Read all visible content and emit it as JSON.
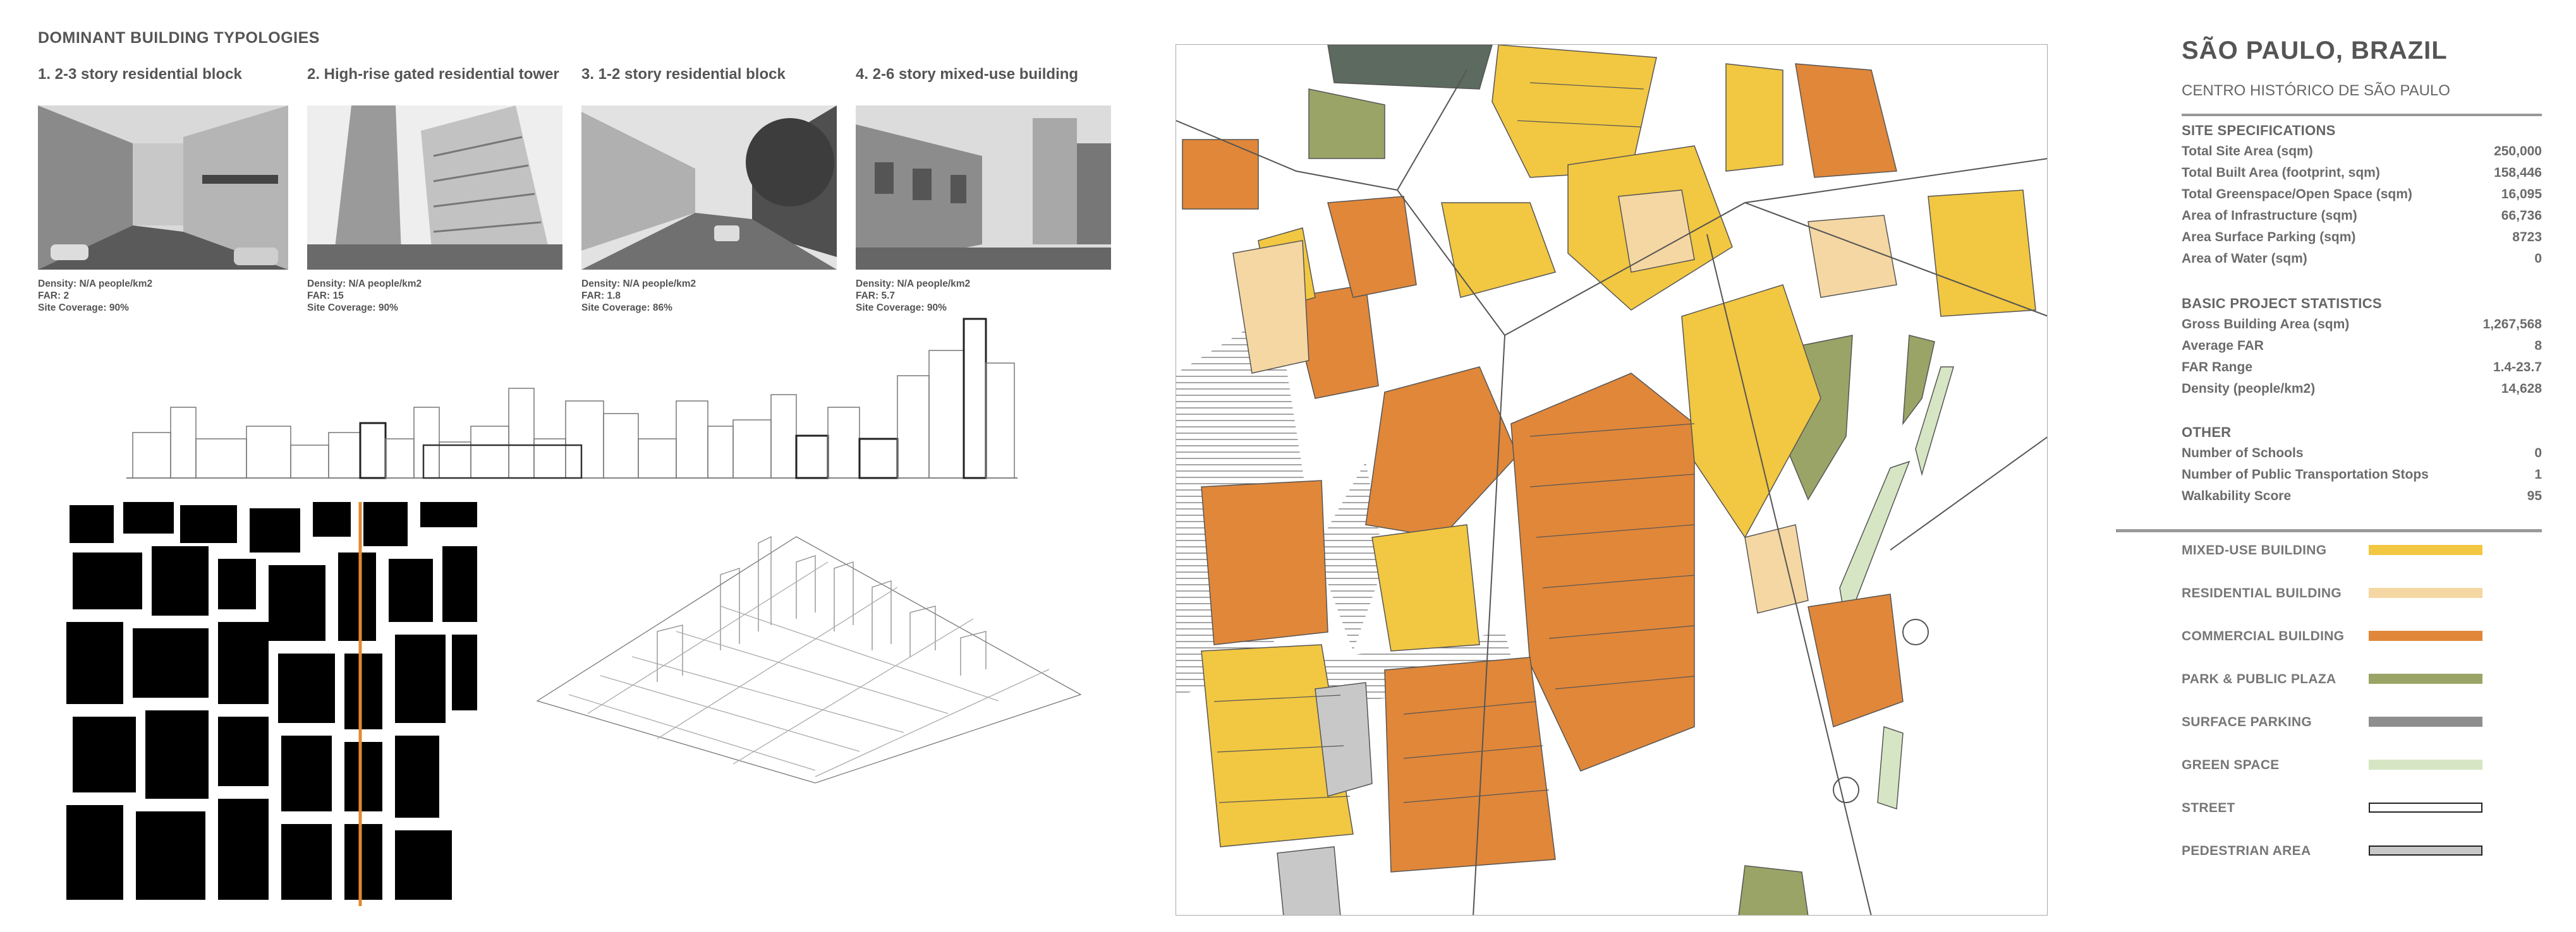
{
  "left": {
    "heading": "DOMINANT BUILDING TYPOLOGIES",
    "typologies": [
      {
        "title": "1. 2-3 story residential block",
        "density": "Density: N/A people/km2",
        "far": "FAR: 2",
        "coverage": "Site Coverage: 90%"
      },
      {
        "title": "2. High-rise gated residential tower",
        "density": "Density: N/A people/km2",
        "far": "FAR: 15",
        "coverage": "Site Coverage: 90%"
      },
      {
        "title": "3. 1-2 story residential block",
        "density": "Density: N/A people/km2",
        "far": "FAR: 1.8",
        "coverage": "Site Coverage: 86%"
      },
      {
        "title": "4. 2-6 story mixed-use building",
        "density": "Density: N/A people/km2",
        "far": "FAR: 5.7",
        "coverage": "Site Coverage: 90%"
      }
    ]
  },
  "right": {
    "title": "SÃO PAULO, BRAZIL",
    "subtitle": "CENTRO HISTÓRICO DE SÃO PAULO",
    "site_specs": {
      "heading": "SITE SPECIFICATIONS",
      "rows": [
        {
          "label": "Total Site Area (sqm)",
          "value": "250,000"
        },
        {
          "label": "Total Built Area (footprint, sqm)",
          "value": "158,446"
        },
        {
          "label": "Total Greenspace/Open Space (sqm)",
          "value": "16,095"
        },
        {
          "label": "Area of Infrastructure (sqm)",
          "value": "66,736"
        },
        {
          "label": "Area Surface Parking (sqm)",
          "value": "8723"
        },
        {
          "label": "Area of Water (sqm)",
          "value": "0"
        }
      ]
    },
    "basic_stats": {
      "heading": "BASIC PROJECT STATISTICS",
      "rows": [
        {
          "label": "Gross Building Area (sqm)",
          "value": "1,267,568"
        },
        {
          "label": "Average FAR",
          "value": "8"
        },
        {
          "label": "FAR Range",
          "value": "1.4-23.7"
        },
        {
          "label": "Density (people/km2)",
          "value": "14,628"
        }
      ]
    },
    "other": {
      "heading": "OTHER",
      "rows": [
        {
          "label": "Number of Schools",
          "value": "0"
        },
        {
          "label": "Number of Public Transportation Stops",
          "value": "1"
        },
        {
          "label": "Walkability Score",
          "value": "95"
        }
      ]
    },
    "legend": [
      {
        "label": "MIXED-USE BUILDING",
        "color": "#f2c741"
      },
      {
        "label": "RESIDENTIAL BUILDING",
        "color": "#f5d7a3"
      },
      {
        "label": "COMMERCIAL BUILDING",
        "color": "#e0873a"
      },
      {
        "label": "PARK & PUBLIC PLAZA",
        "color": "#9aa466"
      },
      {
        "label": "SURFACE PARKING",
        "color": "#8e8e8e"
      },
      {
        "label": "GREEN SPACE",
        "color": "#d6e6c4"
      },
      {
        "label": "STREET",
        "color": "#ffffff"
      },
      {
        "label": "PEDESTRIAN AREA",
        "color": "#c8c8c8"
      }
    ]
  }
}
